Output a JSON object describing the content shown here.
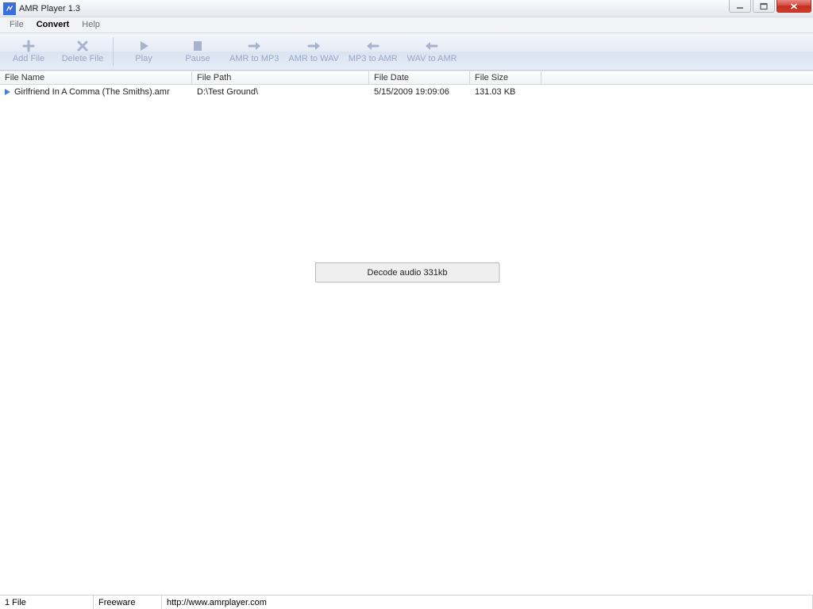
{
  "window": {
    "title": "AMR Player 1.3"
  },
  "menu": {
    "file": "File",
    "convert": "Convert",
    "help": "Help"
  },
  "toolbar": {
    "add_file": "Add File",
    "delete_file": "Delete File",
    "play": "Play",
    "pause": "Pause",
    "amr_to_mp3": "AMR to MP3",
    "amr_to_wav": "AMR to WAV",
    "mp3_to_amr": "MP3 to AMR",
    "wav_to_amr": "WAV to AMR"
  },
  "table": {
    "headers": {
      "name": "File Name",
      "path": "File Path",
      "date": "File Date",
      "size": "File Size"
    },
    "rows": [
      {
        "name": "Girlfriend In A Comma (The Smiths).amr",
        "path": "D:\\Test Ground\\",
        "date": "5/15/2009 19:09:06",
        "size": "131.03 KB"
      }
    ]
  },
  "decode_status": "Decode audio 331kb",
  "status": {
    "file_count": "1 File",
    "license": "Freeware",
    "url": "http://www.amrplayer.com"
  }
}
